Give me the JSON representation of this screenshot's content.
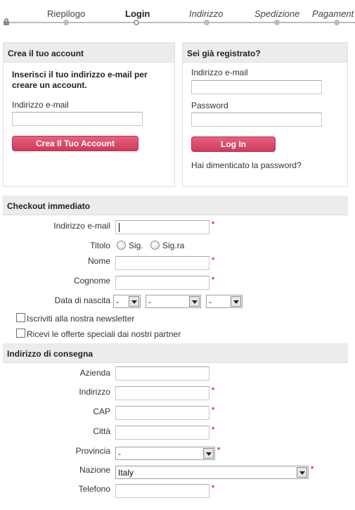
{
  "steps": [
    "Riepilogo",
    "Login",
    "Indirizzo",
    "Spedizione",
    "Pagament"
  ],
  "create_account": {
    "title": "Crea il tuo account",
    "intro": "Inserisci il tuo indirizzo e-mail per creare un account.",
    "email_label": "Indirizzo e-mail",
    "email_value": "",
    "button": "Crea Il Tuo Account"
  },
  "login": {
    "title": "Sei già registrato?",
    "email_label": "Indirizzo e-mail",
    "email_value": "",
    "password_label": "Password",
    "password_value": "",
    "button": "Log In",
    "forgot": "Hai dimenticato la password?"
  },
  "checkout": {
    "title": "Checkout immediato",
    "email_label": "Indirizzo e-mail",
    "title_label": "Titolo",
    "title_options": [
      "Sig.",
      "Sig.ra"
    ],
    "name_label": "Nome",
    "surname_label": "Cognome",
    "birth_label": "Data di nascita",
    "birth_day": "-",
    "birth_month": "-",
    "birth_year": "-",
    "newsletter": "Iscriviti alla nostra newsletter",
    "offers": "Ricevi le offerte speciali dai nostri partner",
    "required_mark": "*"
  },
  "shipping": {
    "title": "Indirizzo di consegna",
    "company_label": "Azienda",
    "address_label": "Indirizzo",
    "zip_label": "CAP",
    "city_label": "Città",
    "province_label": "Provincia",
    "province_value": "-",
    "country_label": "Nazione",
    "country_value": "Italy",
    "phone_label": "Telefono"
  }
}
